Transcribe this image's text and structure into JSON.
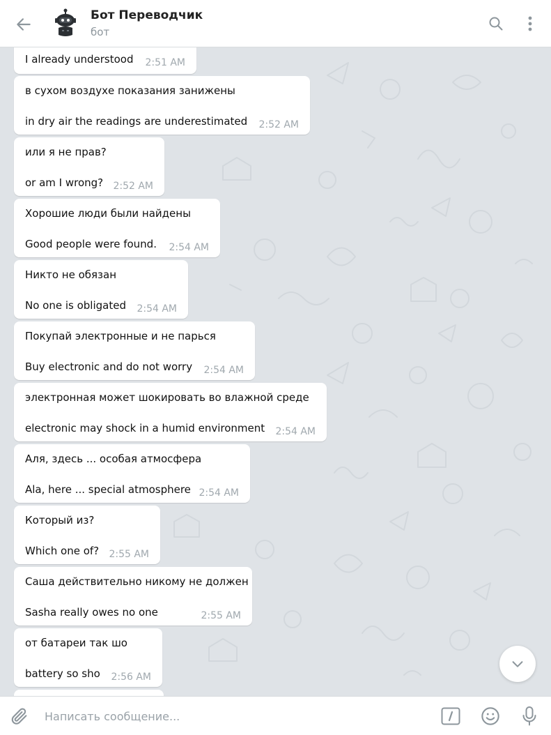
{
  "header": {
    "back_icon": "arrow-left-icon",
    "avatar_icon": "robot-icon",
    "title": "Бот Переводчик",
    "subtitle": "бот",
    "search_icon": "search-icon",
    "menu_icon": "more-vertical-icon"
  },
  "messages": [
    {
      "lines": [
        "I already understood"
      ],
      "time": "2:51 AM"
    },
    {
      "lines": [
        "в сухом воздухе показания занижены",
        "in dry air the readings are underestimated"
      ],
      "time": "2:52 AM"
    },
    {
      "lines": [
        "или я не прав?",
        "or am I wrong?"
      ],
      "time": "2:52 AM"
    },
    {
      "lines": [
        "Хорошие люди были найдены",
        "Good people were found."
      ],
      "time": "2:54 AM"
    },
    {
      "lines": [
        "Никто не обязан",
        "No one is obligated"
      ],
      "time": "2:54 AM"
    },
    {
      "lines": [
        "Покупай электронные и не парься",
        "Buy electronic and do not worry"
      ],
      "time": "2:54 AM"
    },
    {
      "lines": [
        "электронная может шокировать во влажной среде",
        "electronic may shock in a humid environment"
      ],
      "time": "2:54 AM"
    },
    {
      "lines": [
        "Аля, здесь ... особая атмосфера",
        "Ala, here ... special atmosphere"
      ],
      "time": "2:54 AM"
    },
    {
      "lines": [
        "Который из?",
        "Which one of?"
      ],
      "time": "2:55 AM"
    },
    {
      "lines": [
        "Саша действительно никому не должен",
        "Sasha really owes no one"
      ],
      "time": "2:55 AM"
    },
    {
      "lines": [
        "от батареи так шо",
        "battery so sho"
      ],
      "time": "2:56 AM"
    }
  ],
  "scroll_down_icon": "chevron-down-icon",
  "composer": {
    "attach_icon": "paperclip-icon",
    "placeholder": "Написать сообщение...",
    "command_icon": "bot-command-icon",
    "emoji_icon": "smiley-icon",
    "mic_icon": "microphone-icon"
  },
  "colors": {
    "background": "#dfe3e7",
    "bubble": "#ffffff",
    "time": "#a0a8ae",
    "icon": "#8d969c"
  }
}
